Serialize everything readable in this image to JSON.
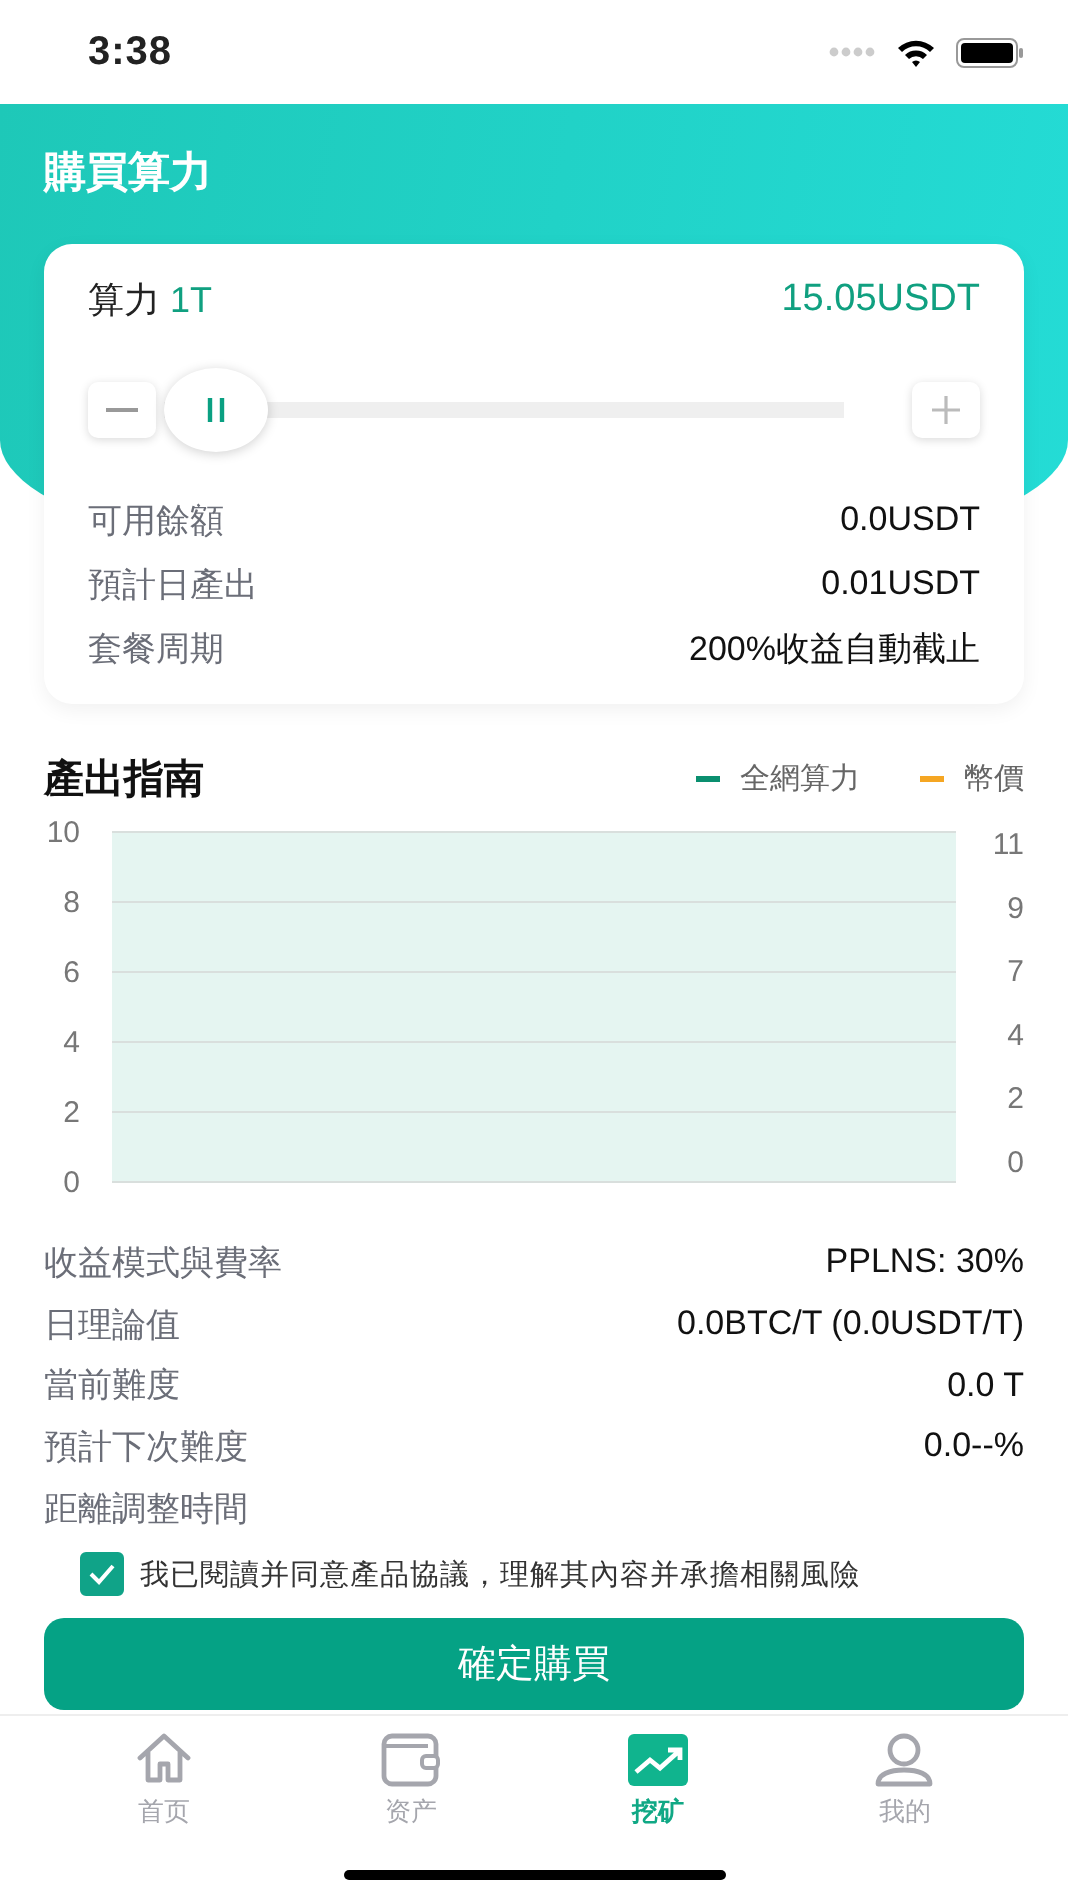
{
  "status_bar": {
    "time": "3:38"
  },
  "header": {
    "title": "購買算力"
  },
  "purchase_card": {
    "hashrate_label": "算力",
    "hashrate_value": "1T",
    "price": "15.05USDT",
    "slider": {
      "level": 0
    },
    "rows": [
      {
        "label": "可用餘額",
        "value": "0.0USDT"
      },
      {
        "label": "預計日產出",
        "value": "0.01USDT"
      },
      {
        "label": "套餐周期",
        "value": "200%收益自動截止"
      }
    ]
  },
  "output_guide": {
    "title": "產出指南",
    "legend": [
      {
        "name": "全網算力",
        "color": "#0a8f6f"
      },
      {
        "name": "幣價",
        "color": "#f5a623"
      }
    ],
    "left_axis_ticks": [
      "10",
      "8",
      "6",
      "4",
      "2",
      "0"
    ],
    "right_axis_ticks": [
      "11",
      "9",
      "7",
      "4",
      "2",
      "0"
    ]
  },
  "info_rows": [
    {
      "label": "收益模式與費率",
      "value": "PPLNS: 30%"
    },
    {
      "label": "日理論值",
      "value": "0.0BTC/T (0.0USDT/T)"
    },
    {
      "label": "當前難度",
      "value": "0.0 T"
    },
    {
      "label": "預計下次難度",
      "value": "0.0--%"
    },
    {
      "label": "距離調整時間"
    }
  ],
  "agreement": {
    "checked": true,
    "text": "我已閱讀并同意產品協議，理解其內容并承擔相關風險"
  },
  "confirm_button": "確定購買",
  "tab_bar": [
    {
      "kind": "home",
      "label": "首页",
      "selected": false
    },
    {
      "kind": "wallet",
      "label": "资产",
      "selected": false
    },
    {
      "kind": "chart",
      "label": "挖矿",
      "selected": true
    },
    {
      "kind": "person",
      "label": "我的",
      "selected": false
    }
  ]
}
